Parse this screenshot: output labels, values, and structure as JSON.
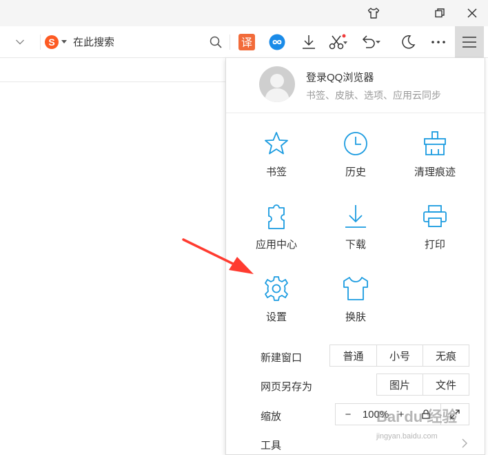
{
  "window_controls": {
    "skin_icon": "tshirt-icon",
    "restore_icon": "restore-icon",
    "close_icon": "close-icon"
  },
  "search": {
    "placeholder": "在此搜索",
    "engine_icon": "sogou-logo-icon"
  },
  "toolbar_icons": [
    "translate-icon",
    "link-icon",
    "download-icon",
    "scissors-icon",
    "undo-icon",
    "moon-icon",
    "more-icon",
    "menu-icon"
  ],
  "menu": {
    "login_title": "登录QQ浏览器",
    "login_subtitle": "书签、皮肤、选项、应用云同步",
    "grid": [
      {
        "label": "书签",
        "icon": "star-icon"
      },
      {
        "label": "历史",
        "icon": "clock-icon"
      },
      {
        "label": "清理痕迹",
        "icon": "broom-icon"
      },
      {
        "label": "应用中心",
        "icon": "puzzle-icon"
      },
      {
        "label": "下载",
        "icon": "download-icon"
      },
      {
        "label": "打印",
        "icon": "printer-icon"
      },
      {
        "label": "设置",
        "icon": "gear-icon"
      },
      {
        "label": "换肤",
        "icon": "tshirt-icon"
      }
    ],
    "new_window": {
      "label": "新建窗口",
      "options": [
        "普通",
        "小号",
        "无痕"
      ]
    },
    "save_as": {
      "label": "网页另存为",
      "options": [
        "图片",
        "文件"
      ]
    },
    "zoom": {
      "label": "缩放",
      "minus": "−",
      "value": "100%",
      "plus": "+"
    },
    "tools": {
      "label": "工具"
    }
  },
  "colors": {
    "accent": "#1a9be0",
    "annotation_arrow": "#ff3b30",
    "menu_button_bg": "#dcdcdc"
  },
  "watermark": {
    "main": "Bai du 经验",
    "sub": "jingyan.baidu.com"
  }
}
